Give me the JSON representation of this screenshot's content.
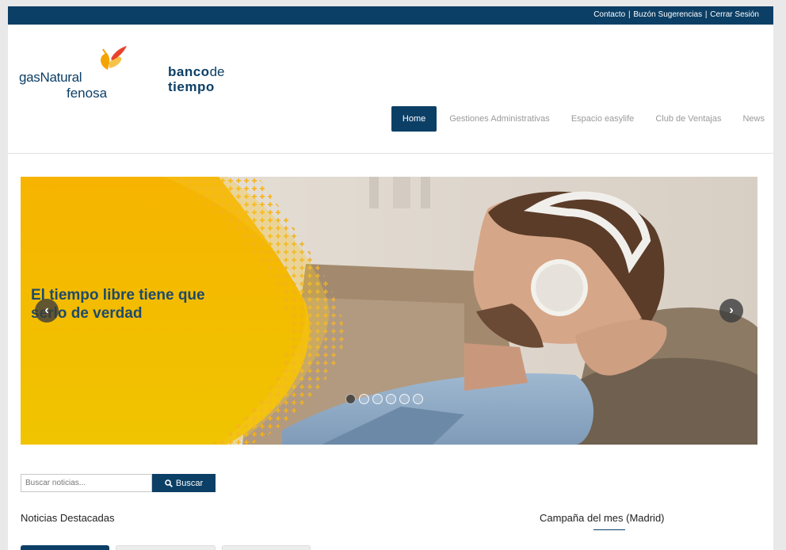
{
  "topbar": {
    "links": [
      "Contacto",
      "Buzón Sugerencias",
      "Cerrar Sesión"
    ],
    "separator": "|"
  },
  "logos": {
    "gas_line1": "gasNatural",
    "gas_line2": "fenosa",
    "banco_bold": "banco",
    "banco_de": "de",
    "banco_line2": "tiempo"
  },
  "nav": {
    "items": [
      "Home",
      "Gestiones Administrativas",
      "Espacio easylife",
      "Club de Ventajas",
      "News"
    ],
    "active": "Home"
  },
  "hero": {
    "headline": "El tiempo libre tiene que serlo de verdad",
    "prev_arrow": "‹",
    "next_arrow": "›",
    "slide_count": 6,
    "active_slide": 1
  },
  "search": {
    "placeholder": "Buscar noticias...",
    "button_label": "Buscar"
  },
  "sections": {
    "featured_news": "Noticias Destacadas",
    "campaign": "Campaña del mes (Madrid)"
  },
  "colors": {
    "brand_navy": "#0c3f66",
    "hero_yellow": "#f4b400"
  }
}
